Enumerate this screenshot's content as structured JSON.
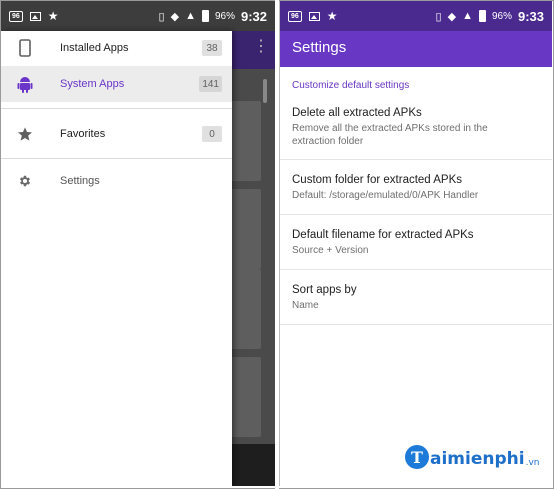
{
  "left_phone": {
    "status": {
      "time": "9:32",
      "battery": "96%",
      "chip": "96"
    },
    "drawer": {
      "items": [
        {
          "label": "Installed Apps",
          "count": "38",
          "icon": "phone-icon",
          "active": false
        },
        {
          "label": "System Apps",
          "count": "141",
          "icon": "android-icon",
          "active": true
        },
        {
          "label": "Favorites",
          "count": "0",
          "icon": "star-icon",
          "active": false
        },
        {
          "label": "Settings",
          "icon": "gear-icon",
          "active": false
        }
      ]
    }
  },
  "right_phone": {
    "status": {
      "time": "9:33",
      "battery": "96%",
      "chip": "96"
    },
    "title": "Settings",
    "category": "Customize default settings",
    "prefs": [
      {
        "title": "Delete all extracted APKs",
        "summary": "Remove all the extracted APKs stored in the extraction folder"
      },
      {
        "title": "Custom folder for extracted APKs",
        "summary": "Default: /storage/emulated/0/APK Handler"
      },
      {
        "title": "Default filename for extracted APKs",
        "summary": "Source + Version"
      },
      {
        "title": "Sort apps by",
        "summary": "Name"
      }
    ]
  },
  "watermark": {
    "logo_letter": "T",
    "text": "aimienphi",
    "suffix": ".vn"
  },
  "colors": {
    "accent": "#6838c4",
    "status_right": "#4a2a8f",
    "watermark": "#1e6fc9"
  }
}
